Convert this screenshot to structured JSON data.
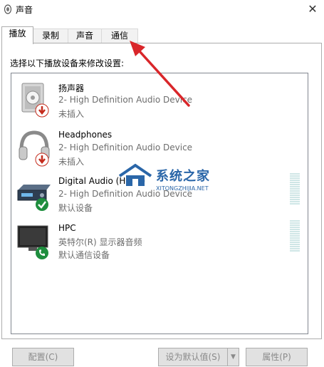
{
  "window": {
    "title": "声音",
    "close_symbol": "✕",
    "icon": "speaker-icon"
  },
  "tabs": [
    {
      "label": "播放",
      "active": true
    },
    {
      "label": "录制",
      "active": false
    },
    {
      "label": "声音",
      "active": false
    },
    {
      "label": "通信",
      "active": false
    }
  ],
  "instruction": "选择以下播放设备来修改设置:",
  "devices": [
    {
      "name": "扬声器",
      "description": "2- High Definition Audio Device",
      "status": "未插入",
      "icon": "speaker-icon",
      "badge": "unplugged-arrow-icon"
    },
    {
      "name": "Headphones",
      "description": "2- High Definition Audio Device",
      "status": "未插入",
      "icon": "headphones-icon",
      "badge": "unplugged-arrow-icon"
    },
    {
      "name": "Digital Audio (HDMI)",
      "description": "2- High Definition Audio Device",
      "status": "默认设备",
      "icon": "receiver-icon",
      "badge": "default-check-icon"
    },
    {
      "name": "HPC",
      "description": "英特尔(R) 显示器音频",
      "status": "默认通信设备",
      "icon": "monitor-icon",
      "badge": "phone-icon"
    }
  ],
  "watermark": {
    "text": "系统之家",
    "subtext": "XITONGZHIJIA.NET"
  },
  "buttons": {
    "configure": "配置(C)",
    "set_default": "设为默认值(S)",
    "set_default_arrow": "▼",
    "properties": "属性(P)"
  },
  "colors": {
    "accent_arrow": "#d9262a",
    "badge_red": "#c42b1c",
    "badge_green": "#1e8e3e",
    "meter": "#cfe6e6"
  }
}
